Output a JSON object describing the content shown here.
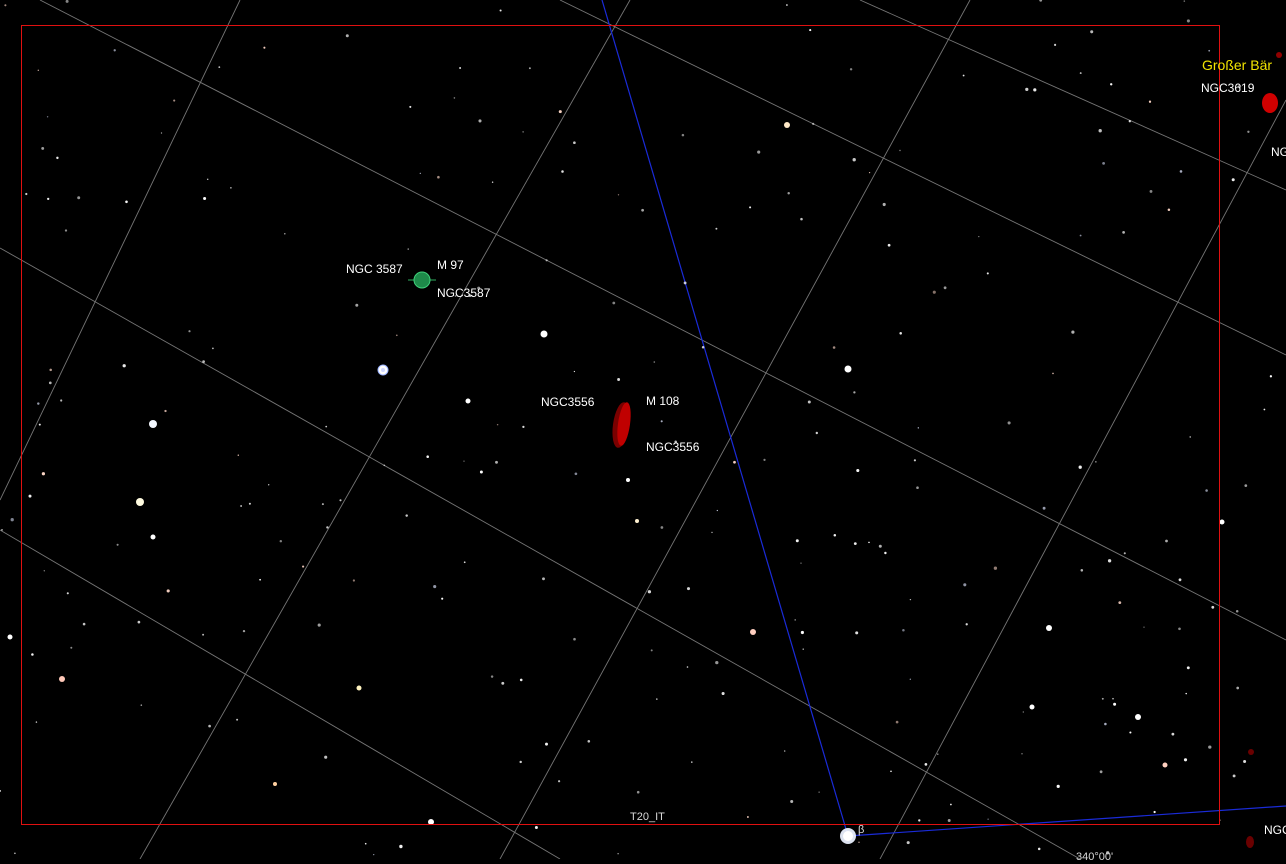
{
  "constellation": {
    "name": "Großer Bär",
    "color": "#f2e400"
  },
  "fov": {
    "name": "T20_IT",
    "color": "#e01010"
  },
  "objects": {
    "m97": {
      "messier": "M 97",
      "ngc_label": "NGC 3587",
      "ngc_id": "NGC3587",
      "type": "planetary-nebula",
      "color": "#1e8a4a"
    },
    "m108": {
      "messier": "M 108",
      "ngc_left": "NGC3556",
      "ngc_id": "NGC3556",
      "type": "galaxy",
      "color": "#c00000"
    },
    "ngc3619": {
      "label": "NGC3619",
      "type": "galaxy",
      "color": "#d00000"
    },
    "edge_label_right": "NG",
    "edge_label_bottom": "NGC"
  },
  "stars": {
    "beta_label": "β"
  },
  "grid": {
    "ra_label": "340°00'"
  },
  "colors": {
    "background": "#000000",
    "grid_lines": "#8a8a8a",
    "ecliptic_line": "#1a2bd8"
  }
}
